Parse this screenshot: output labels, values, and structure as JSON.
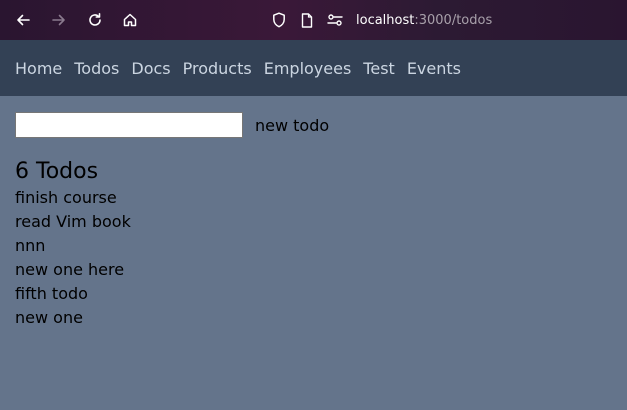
{
  "browser": {
    "url_host": "localhost",
    "url_path": ":3000/todos"
  },
  "nav": {
    "links": [
      "Home",
      "Todos",
      "Docs",
      "Products",
      "Employees",
      "Test",
      "Events"
    ]
  },
  "form": {
    "input_value": "",
    "label": "new todo"
  },
  "todos": {
    "heading": "6 Todos",
    "items": [
      "finish course",
      "read Vim book",
      "nnn",
      "new one here",
      "fifth todo",
      "new one"
    ]
  }
}
